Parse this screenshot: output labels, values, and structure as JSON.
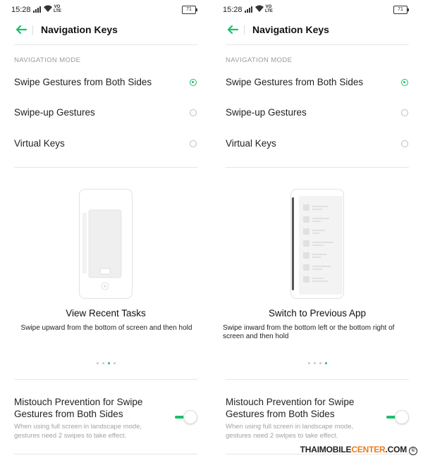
{
  "status_bar": {
    "time": "15:28",
    "battery": "71",
    "volte": "VO LTE"
  },
  "screens": [
    {
      "title": "Navigation Keys",
      "section_label": "NAVIGATION MODE",
      "options": [
        {
          "label": "Swipe Gestures from Both Sides",
          "selected": true
        },
        {
          "label": "Swipe-up Gestures",
          "selected": false
        },
        {
          "label": "Virtual Keys",
          "selected": false
        }
      ],
      "illustration": {
        "caption": "View Recent Tasks",
        "description": "Swipe upward from the bottom of screen and then hold",
        "active_page": 3,
        "page_count": 4
      },
      "mistouch": {
        "title": "Mistouch Prevention for Swipe Gestures from Both Sides",
        "description": "When using full screen in landscape mode, gestures need 2 swipes to take effect.",
        "enabled": true
      }
    },
    {
      "title": "Navigation Keys",
      "section_label": "NAVIGATION MODE",
      "options": [
        {
          "label": "Swipe Gestures from Both Sides",
          "selected": true
        },
        {
          "label": "Swipe-up Gestures",
          "selected": false
        },
        {
          "label": "Virtual Keys",
          "selected": false
        }
      ],
      "illustration": {
        "caption": "Switch to Previous App",
        "description": "Swipe inward from the bottom left or the bottom right of screen and then hold",
        "active_page": 4,
        "page_count": 4
      },
      "mistouch": {
        "title": "Mistouch Prevention for Swipe Gestures from Both Sides",
        "description": "When using full screen in landscape mode, gestures need 2 swipes to take effect.",
        "enabled": true
      }
    }
  ],
  "watermark": {
    "part1": "THAIMOBILE",
    "part2": "CENTER",
    "part3": ".COM",
    "symbol": "©"
  },
  "colors": {
    "accent": "#1bbf6b",
    "divider": "#e6e6e6",
    "muted_text": "#9a9a9a",
    "watermark_accent": "#e87d1e"
  },
  "icons": [
    "back-arrow-icon",
    "signal-icon",
    "wifi-icon",
    "battery-icon",
    "copyright-icon"
  ]
}
